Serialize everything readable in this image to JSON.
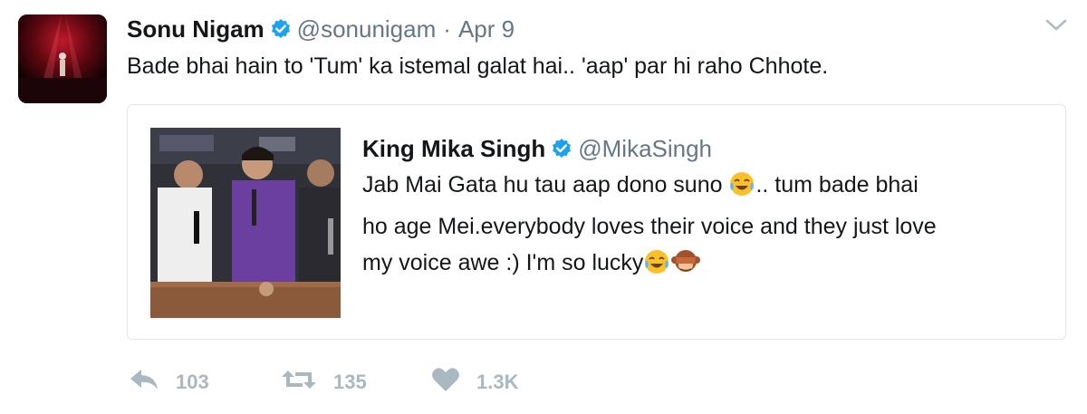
{
  "tweet": {
    "author_name": "Sonu Nigam",
    "handle": "@sonunigam",
    "separator": "·",
    "date": "Apr 9",
    "text": "Bade bhai hain to 'Tum' ka istemal galat hai.. 'aap' par hi raho Chhote."
  },
  "quoted": {
    "author_name": "King Mika Singh",
    "handle": "@MikaSingh",
    "line1_a": "Jab Mai Gata hu tau aap dono suno ",
    "line1_b": ".. tum bade bhai",
    "line2": "ho age Mei.everybody loves their voice and they just love",
    "line3": "my voice awe :) I'm so lucky",
    "emojis": [
      "face-with-tears-of-joy",
      "face-with-tears-of-joy",
      "see-no-evil-monkey"
    ]
  },
  "actions": {
    "reply_count": "103",
    "retweet_count": "135",
    "like_count": "1.3K"
  },
  "colors": {
    "text": "#14171a",
    "secondary": "#657786",
    "verified": "#1da1f2",
    "action": "#aab8c2",
    "border": "#e1e8ed"
  },
  "icons": [
    "verified-badge-icon",
    "chevron-down-icon",
    "reply-icon",
    "retweet-icon",
    "heart-icon"
  ]
}
